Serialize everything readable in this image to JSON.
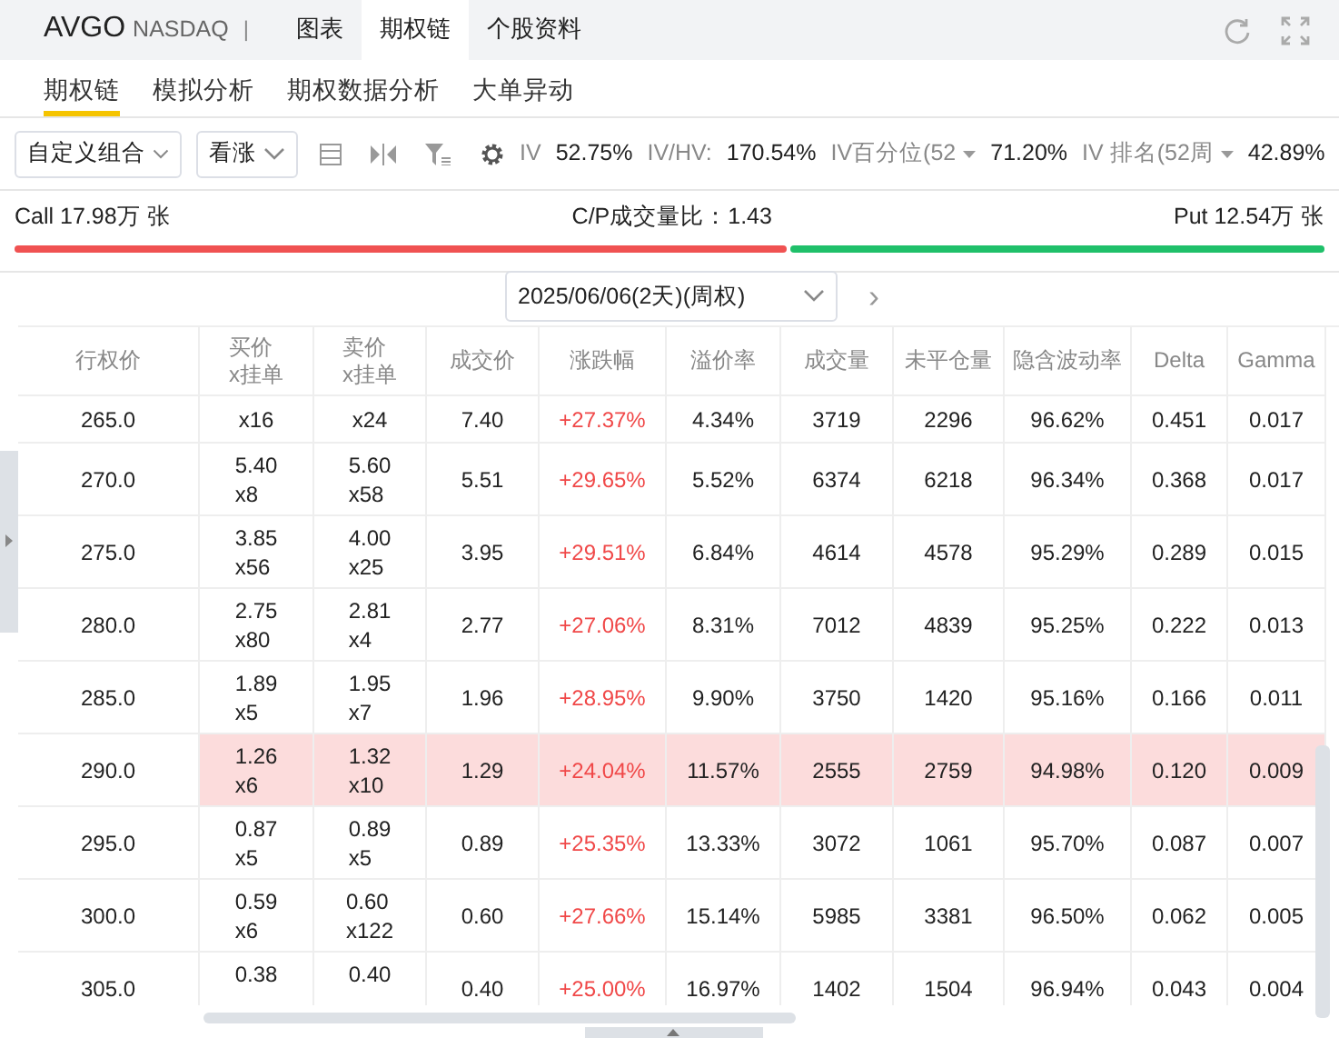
{
  "header": {
    "symbol": "AVGO",
    "exchange": "NASDAQ",
    "separator": "|",
    "tabs": [
      {
        "label": "图表",
        "selected": false
      },
      {
        "label": "期权链",
        "selected": true
      },
      {
        "label": "个股资料",
        "selected": false
      }
    ]
  },
  "subtabs": [
    {
      "label": "期权链",
      "selected": true
    },
    {
      "label": "模拟分析",
      "selected": false
    },
    {
      "label": "期权数据分析",
      "selected": false
    },
    {
      "label": "大单异动",
      "selected": false
    }
  ],
  "toolbar": {
    "combo": "自定义组合",
    "direction": "看涨",
    "stats": [
      {
        "label": "IV",
        "value": "52.75%",
        "dropdown": false
      },
      {
        "label": "IV/HV:",
        "value": "170.54%",
        "dropdown": false
      },
      {
        "label": "IV百分位(52",
        "value": "71.20%",
        "dropdown": true
      },
      {
        "label": "IV 排名(52周",
        "value": "42.89%",
        "dropdown": true
      }
    ]
  },
  "ratio": {
    "call": "Call 17.98万 张",
    "ratio": "C/P成交量比：1.43",
    "put": "Put 12.54万 张",
    "level": 0.589
  },
  "expiry": {
    "value": "2025/06/06(2天)(周权)",
    "next": "›"
  },
  "table": {
    "columns": [
      [
        "行权价"
      ],
      [
        "买价",
        "x挂单"
      ],
      [
        "卖价",
        "x挂单"
      ],
      [
        "成交价"
      ],
      [
        "涨跌幅"
      ],
      [
        "溢价率"
      ],
      [
        "成交量"
      ],
      [
        "未平仓量"
      ],
      [
        "隐含波动率"
      ],
      [
        "Delta"
      ],
      [
        "Gamma"
      ]
    ],
    "rows": [
      {
        "strike": "265.0",
        "bid": "",
        "bid_qty": "x16",
        "ask": "",
        "ask_qty": "x24",
        "last": "7.40",
        "change": "+27.37%",
        "premium": "4.34%",
        "volume": "3719",
        "oi": "2296",
        "iv": "96.62%",
        "delta": "0.451",
        "gamma": "0.017",
        "highlight": false
      },
      {
        "strike": "270.0",
        "bid": "5.40",
        "bid_qty": "x8",
        "ask": "5.60",
        "ask_qty": "x58",
        "last": "5.51",
        "change": "+29.65%",
        "premium": "5.52%",
        "volume": "6374",
        "oi": "6218",
        "iv": "96.34%",
        "delta": "0.368",
        "gamma": "0.017",
        "highlight": false
      },
      {
        "strike": "275.0",
        "bid": "3.85",
        "bid_qty": "x56",
        "ask": "4.00",
        "ask_qty": "x25",
        "last": "3.95",
        "change": "+29.51%",
        "premium": "6.84%",
        "volume": "4614",
        "oi": "4578",
        "iv": "95.29%",
        "delta": "0.289",
        "gamma": "0.015",
        "highlight": false
      },
      {
        "strike": "280.0",
        "bid": "2.75",
        "bid_qty": "x80",
        "ask": "2.81",
        "ask_qty": "x4",
        "last": "2.77",
        "change": "+27.06%",
        "premium": "8.31%",
        "volume": "7012",
        "oi": "4839",
        "iv": "95.25%",
        "delta": "0.222",
        "gamma": "0.013",
        "highlight": false
      },
      {
        "strike": "285.0",
        "bid": "1.89",
        "bid_qty": "x5",
        "ask": "1.95",
        "ask_qty": "x7",
        "last": "1.96",
        "change": "+28.95%",
        "premium": "9.90%",
        "volume": "3750",
        "oi": "1420",
        "iv": "95.16%",
        "delta": "0.166",
        "gamma": "0.011",
        "highlight": false
      },
      {
        "strike": "290.0",
        "bid": "1.26",
        "bid_qty": "x6",
        "ask": "1.32",
        "ask_qty": "x10",
        "last": "1.29",
        "change": "+24.04%",
        "premium": "11.57%",
        "volume": "2555",
        "oi": "2759",
        "iv": "94.98%",
        "delta": "0.120",
        "gamma": "0.009",
        "highlight": true
      },
      {
        "strike": "295.0",
        "bid": "0.87",
        "bid_qty": "x5",
        "ask": "0.89",
        "ask_qty": "x5",
        "last": "0.89",
        "change": "+25.35%",
        "premium": "13.33%",
        "volume": "3072",
        "oi": "1061",
        "iv": "95.70%",
        "delta": "0.087",
        "gamma": "0.007",
        "highlight": false
      },
      {
        "strike": "300.0",
        "bid": "0.59",
        "bid_qty": "x6",
        "ask": "0.60",
        "ask_qty": "x122",
        "last": "0.60",
        "change": "+27.66%",
        "premium": "15.14%",
        "volume": "5985",
        "oi": "3381",
        "iv": "96.50%",
        "delta": "0.062",
        "gamma": "0.005",
        "highlight": false
      },
      {
        "strike": "305.0",
        "bid": "0.38",
        "bid_qty": "",
        "ask": "0.40",
        "ask_qty": "",
        "last": "0.40",
        "change": "+25.00%",
        "premium": "16.97%",
        "volume": "1402",
        "oi": "1504",
        "iv": "96.94%",
        "delta": "0.043",
        "gamma": "0.004",
        "highlight": false
      }
    ]
  }
}
